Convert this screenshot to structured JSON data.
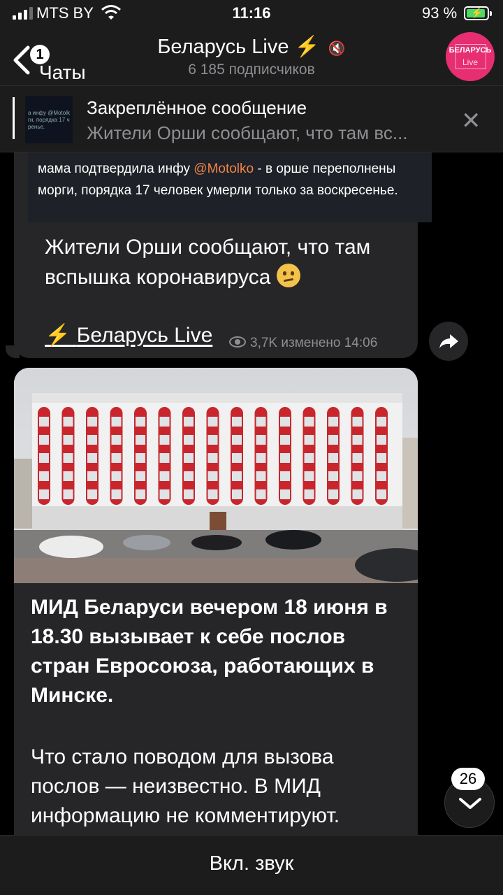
{
  "status_bar": {
    "carrier": "MTS BY",
    "time": "11:16",
    "battery_percent": "93 %",
    "signal_bars": 3
  },
  "header": {
    "back_label": "Чаты",
    "back_badge": "1",
    "title": "Беларусь Live",
    "title_icon": "lightning-emoji",
    "mute_icon": "muted-speaker-icon",
    "subscribers": "6 185 подписчиков",
    "avatar_line1": "БЕЛАРУСЬ",
    "avatar_line2": "Live",
    "avatar_color": "#e62e71"
  },
  "pinned": {
    "title": "Закреплённое сообщение",
    "text": "Жители Орши сообщают, что там вс...",
    "thumb_text": "а инфу @Motolk ги, порядка 17 ч ренье."
  },
  "message1": {
    "quote_before": "мама подтвердила инфу ",
    "quote_mention": "@Motolko",
    "quote_after": " - в орше переполнены морги, порядка 17 человек умерли только за воскресенье.",
    "text": "Жители Орши сообщают, что там вспышка коронавируса",
    "emoji": "confused-face-emoji",
    "signature_name": "Беларусь Live",
    "views": "3,7K",
    "edited_time": "изменено 14:06"
  },
  "message2": {
    "bold_text": "МИД Беларуси вечером 18 июня в 18.30 вызывает к себе послов стран Евросоюза, работающих в Минске.",
    "text": "Что стало поводом для вызова послов — неизвестно. В МИД информацию не комментируют.",
    "photo": "ministry-building-photo"
  },
  "scroll_down": {
    "count": "26"
  },
  "bottom_bar": {
    "label": "Вкл. звук"
  },
  "colors": {
    "bubble": "#262628",
    "header": "#1c1c1d",
    "accent_orange": "#f0844a",
    "lightning": "#f7c021"
  }
}
